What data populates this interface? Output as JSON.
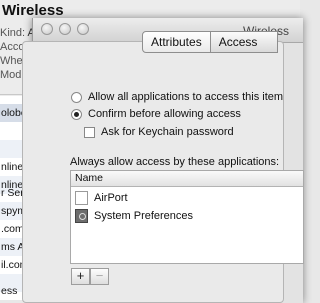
{
  "background": {
    "title": "Wireless",
    "meta": [
      {
        "key": "Kind:",
        "value": "A"
      },
      {
        "key": "Accoun",
        "value": ""
      },
      {
        "key": "Where:",
        "value": ""
      },
      {
        "key": "Modifie",
        "value": ""
      }
    ],
    "list": [
      "olobo0",
      "",
      "",
      "nline.ne",
      "nline.ne",
      "r Servic",
      "spymac",
      ".com",
      "ms Aut",
      "il.com",
      "",
      "",
      "ess"
    ]
  },
  "dialog": {
    "title": "Wireless",
    "tabs": [
      "Attributes",
      "Access"
    ],
    "options": {
      "allow_all": "Allow all applications to access this item",
      "confirm": "Confirm before allowing access",
      "ask_password": "Ask for Keychain password"
    },
    "apps_label": "Always allow access by these applications:",
    "apps_table": {
      "column": "Name",
      "rows": [
        "AirPort",
        "System Preferences"
      ]
    },
    "add_label": "+",
    "remove_label": "−"
  }
}
